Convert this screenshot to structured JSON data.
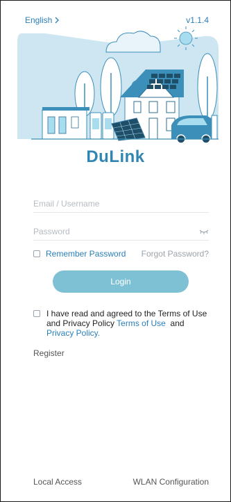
{
  "header": {
    "language": "English",
    "version": "v1.1.4"
  },
  "brand": {
    "name": "DuLink",
    "color": "#2f86b3"
  },
  "form": {
    "email_placeholder": "Email / Username",
    "password_placeholder": "Password",
    "remember_label": "Remember Password",
    "forgot_label": "Forgot Password?",
    "login_label": "Login"
  },
  "terms": {
    "prefix": "I have read and agreed to the Terms of Use and Privacy Policy",
    "terms_link": "Terms of Use",
    "and": "and",
    "privacy_link": "Privacy Policy."
  },
  "register_label": "Register",
  "footer": {
    "local_access": "Local Access",
    "wlan_config": "WLAN Configuration"
  },
  "colors": {
    "accent": "#2a7fb8",
    "button": "#7fc1d4",
    "illustration_bg": "#cde6f1",
    "sun": "#a8dcef"
  },
  "icons": [
    "chevron-right-icon",
    "eye-closed-icon",
    "checkbox-icon"
  ]
}
